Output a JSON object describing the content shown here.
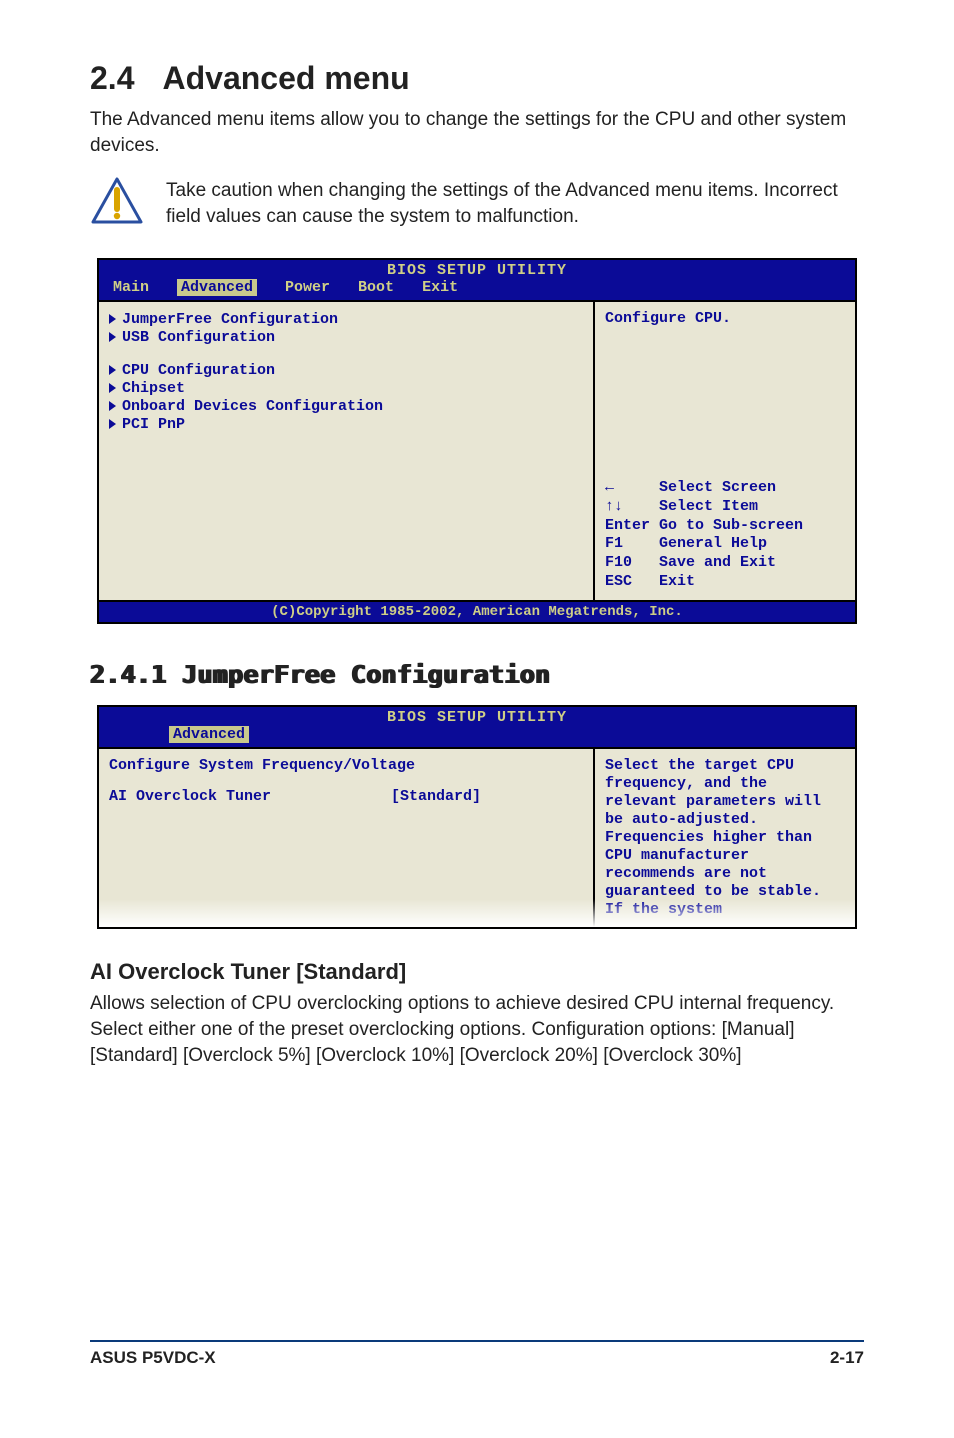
{
  "heading": {
    "num": "2.4",
    "title": "Advanced menu"
  },
  "intro": "The Advanced menu items allow you to change the settings for the CPU and other system devices.",
  "caution": "Take caution when changing the settings of the Advanced menu items. Incorrect field values can cause the system to malfunction.",
  "bios1": {
    "title": "BIOS SETUP UTILITY",
    "tabs": {
      "t0": "Main",
      "t1": "Advanced",
      "t2": "Power",
      "t3": "Boot",
      "t4": "Exit"
    },
    "items": {
      "i0": "JumperFree Configuration",
      "i1": "USB Configuration",
      "i2": "CPU Configuration",
      "i3": "Chipset",
      "i4": "Onboard Devices Configuration",
      "i5": "PCI PnP"
    },
    "help_title": "Configure CPU.",
    "nav": {
      "l0": "←     Select Screen",
      "l1": "↑↓    Select Item",
      "l2": "Enter Go to Sub-screen",
      "l3": "F1    General Help",
      "l4": "F10   Save and Exit",
      "l5": "ESC   Exit"
    },
    "copyright": "(C)Copyright 1985-2002, American Megatrends, Inc."
  },
  "section241": "2.4.1  JumperFree Configuration",
  "bios2": {
    "title": "BIOS SETUP UTILITY",
    "tab": "Advanced",
    "left": {
      "header": "Configure System Frequency/Voltage",
      "item_label": "AI Overclock Tuner",
      "item_value": "[Standard]"
    },
    "help": "Select the target CPU frequency, and the relevant parameters will be auto-adjusted. Frequencies higher than CPU manufacturer recommends are not guaranteed to be stable. If the system"
  },
  "ai_tuner": {
    "heading": "AI Overclock Tuner [Standard]",
    "body": "Allows selection of CPU overclocking options to achieve desired CPU internal frequency. Select either one of the preset overclocking options. Configuration options: [Manual] [Standard] [Overclock 5%] [Overclock 10%] [Overclock 20%] [Overclock 30%]"
  },
  "chart_data": null,
  "footer": {
    "left": "ASUS P5VDC-X",
    "right": "2-17"
  }
}
